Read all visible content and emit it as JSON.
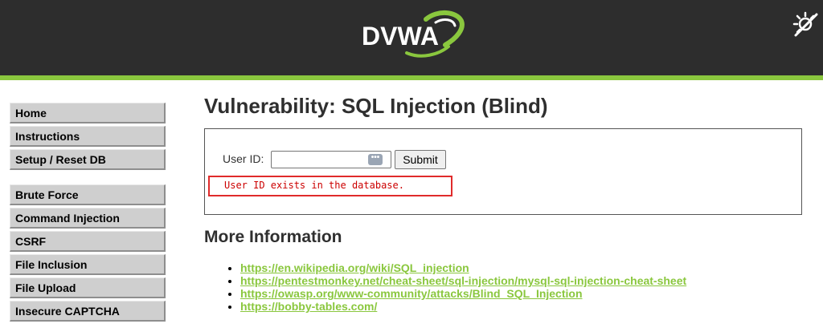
{
  "header": {
    "logo_text": "DVWA",
    "brand_color": "#8ac73e",
    "background_color": "#2d2d2d",
    "theme_toggle_icon": "theme-toggle-icon"
  },
  "sidebar": {
    "groups": [
      [
        "Home",
        "Instructions",
        "Setup / Reset DB"
      ],
      [
        "Brute Force",
        "Command Injection",
        "CSRF",
        "File Inclusion",
        "File Upload",
        "Insecure CAPTCHA"
      ]
    ]
  },
  "main": {
    "title": "Vulnerability: SQL Injection (Blind)",
    "form": {
      "userid_label": "User ID:",
      "userid_value": "",
      "submit_label": "Submit",
      "input_icon": "dots-icon"
    },
    "result": {
      "message": "User ID exists in the database.",
      "color": "#cc0000",
      "highlight_color": "#e02b2b"
    },
    "more_info": {
      "heading": "More Information",
      "links": [
        "https://en.wikipedia.org/wiki/SQL_injection",
        "https://pentestmonkey.net/cheat-sheet/sql-injection/mysql-sql-injection-cheat-sheet",
        "https://owasp.org/www-community/attacks/Blind_SQL_Injection",
        "https://bobby-tables.com/"
      ]
    }
  }
}
